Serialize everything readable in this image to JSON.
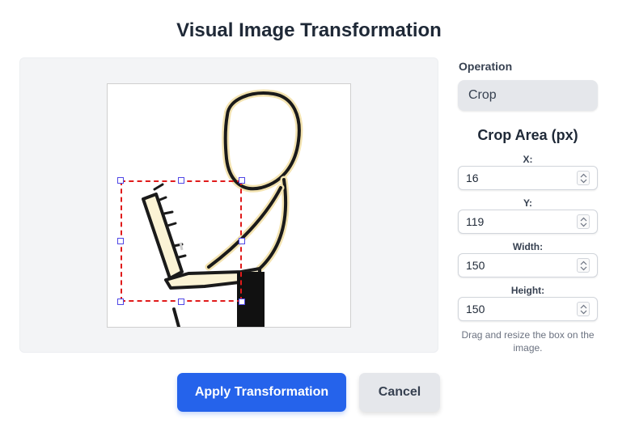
{
  "title": "Visual Image Transformation",
  "operation": {
    "label": "Operation",
    "selected": "Crop"
  },
  "crop": {
    "title": "Crop Area (px)",
    "x_label": "X:",
    "x_value": "16",
    "y_label": "Y:",
    "y_value": "119",
    "width_label": "Width:",
    "width_value": "150",
    "height_label": "Height:",
    "height_value": "150",
    "hint": "Drag and resize the box on the image."
  },
  "buttons": {
    "apply": "Apply Transformation",
    "cancel": "Cancel"
  },
  "colors": {
    "primary": "#2563eb",
    "crop_border": "#e01b1b",
    "handle_border": "#4f46e5"
  }
}
